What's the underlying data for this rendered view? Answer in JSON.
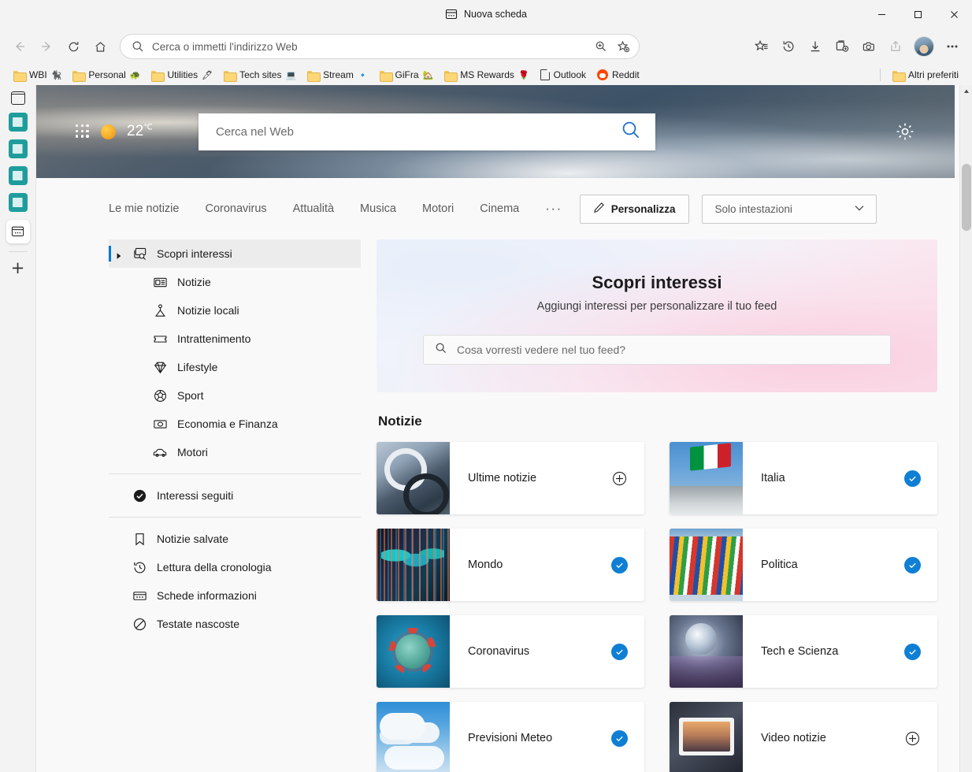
{
  "window": {
    "tab_title": "Nuova scheda",
    "minimize": "–",
    "maximize": "☐",
    "close": "✕"
  },
  "toolbar": {
    "back_icon": "back-arrow-icon",
    "forward_icon": "forward-arrow-icon",
    "refresh_icon": "refresh-icon",
    "home_icon": "home-icon",
    "address_placeholder": "Cerca o immetti l'indirizzo Web",
    "zoom_icon": "zoom-in-icon",
    "favorite_icon": "add-favorite-icon",
    "collections_favorites_icon": "favorites-list-icon",
    "history_icon": "history-icon",
    "downloads_icon": "downloads-icon",
    "collections_icon": "collections-icon",
    "screenshot_icon": "web-capture-icon",
    "share_icon": "share-icon",
    "profile_icon": "profile-avatar",
    "settings_icon": "more-options-icon"
  },
  "bookmarks": {
    "items": [
      {
        "label": "WBI",
        "icon": "folder-icon",
        "emoji": "🐈‍⬛"
      },
      {
        "label": "Personal",
        "icon": "folder-icon",
        "emoji": "🐢"
      },
      {
        "label": "Utilities",
        "icon": "folder-icon",
        "emoji": "🖊"
      },
      {
        "label": "Tech sites",
        "icon": "folder-icon",
        "emoji": "💻"
      },
      {
        "label": "Stream",
        "icon": "folder-icon",
        "emoji": "🔹"
      },
      {
        "label": "GiFra",
        "icon": "folder-icon",
        "emoji": "🏡"
      },
      {
        "label": "MS Rewards",
        "icon": "folder-icon",
        "emoji": "🌹"
      },
      {
        "label": "Outlook",
        "icon": "page-icon",
        "emoji": ""
      },
      {
        "label": "Reddit",
        "icon": "reddit-icon",
        "emoji": ""
      }
    ],
    "other_favorites": "Altri preferiti"
  },
  "rail": {
    "items": [
      {
        "name": "tab-actions-icon",
        "style": "outline"
      },
      {
        "name": "vertical-tab-1",
        "style": "teal"
      },
      {
        "name": "vertical-tab-2",
        "style": "teal"
      },
      {
        "name": "vertical-tab-3",
        "style": "teal"
      },
      {
        "name": "vertical-tab-4",
        "style": "teal"
      },
      {
        "name": "vertical-tab-active",
        "style": "active"
      }
    ],
    "add_tab": "+"
  },
  "hero": {
    "grid_icon": "app-grid-icon",
    "weather_icon": "sun-icon",
    "temperature": "22",
    "unit": "℃",
    "search_placeholder": "Cerca nel Web",
    "search_icon": "search-icon",
    "settings_icon": "gear-icon"
  },
  "nav": {
    "tabs": [
      "Le mie notizie",
      "Coronavirus",
      "Attualità",
      "Musica",
      "Motori",
      "Cinema"
    ],
    "more": "···",
    "personalize_label": "Personalizza",
    "personalize_icon": "pencil-icon",
    "layout_select_value": "Solo intestazioni",
    "layout_select_icon": "chevron-down-icon"
  },
  "sidebar": {
    "top": {
      "label": "Scopri interessi",
      "icon": "discover-interests-icon",
      "caret": "expand-caret-icon"
    },
    "categories": [
      {
        "label": "Notizie",
        "icon": "news-icon"
      },
      {
        "label": "Notizie locali",
        "icon": "local-news-icon"
      },
      {
        "label": "Intrattenimento",
        "icon": "entertainment-ticket-icon"
      },
      {
        "label": "Lifestyle",
        "icon": "diamond-icon"
      },
      {
        "label": "Sport",
        "icon": "soccer-ball-icon"
      },
      {
        "label": "Economia e Finanza",
        "icon": "money-icon"
      },
      {
        "label": "Motori",
        "icon": "car-icon"
      }
    ],
    "followed": {
      "label": "Interessi seguiti",
      "icon": "check-circle-icon"
    },
    "others": [
      {
        "label": "Notizie salvate",
        "icon": "bookmark-icon"
      },
      {
        "label": "Lettura della cronologia",
        "icon": "history-clock-icon"
      },
      {
        "label": "Schede informazioni",
        "icon": "info-cards-icon"
      },
      {
        "label": "Testate nascoste",
        "icon": "hidden-publishers-icon"
      }
    ]
  },
  "discover": {
    "title": "Scopri interessi",
    "subtitle": "Aggiungi interessi per personalizzare il tuo feed",
    "search_placeholder": "Cosa vorresti vedere nel tuo feed?",
    "search_icon": "search-icon"
  },
  "section": {
    "title": "Notizie",
    "cards": [
      {
        "label": "Ultime notizie",
        "thumb": "th-cuffs",
        "state": "add",
        "action_icon": "plus-circle-icon"
      },
      {
        "label": "Italia",
        "thumb": "th-flag",
        "state": "followed",
        "action_icon": "check-circle-icon"
      },
      {
        "label": "Mondo",
        "thumb": "th-world",
        "state": "followed",
        "action_icon": "check-circle-icon"
      },
      {
        "label": "Politica",
        "thumb": "th-flags",
        "state": "followed",
        "action_icon": "check-circle-icon"
      },
      {
        "label": "Coronavirus",
        "thumb": "th-virus",
        "state": "followed",
        "action_icon": "check-circle-icon"
      },
      {
        "label": "Tech e Scienza",
        "thumb": "th-tech",
        "state": "followed",
        "action_icon": "check-circle-icon"
      },
      {
        "label": "Previsioni Meteo",
        "thumb": "th-weather",
        "state": "followed",
        "action_icon": "check-circle-icon"
      },
      {
        "label": "Video notizie",
        "thumb": "th-video",
        "state": "add",
        "action_icon": "plus-circle-icon"
      }
    ]
  },
  "colors": {
    "accent": "#0f7fd4",
    "selection_bar": "#0078d4",
    "chrome_bg": "#f3f3f3",
    "page_bg": "#f9f9f9"
  }
}
